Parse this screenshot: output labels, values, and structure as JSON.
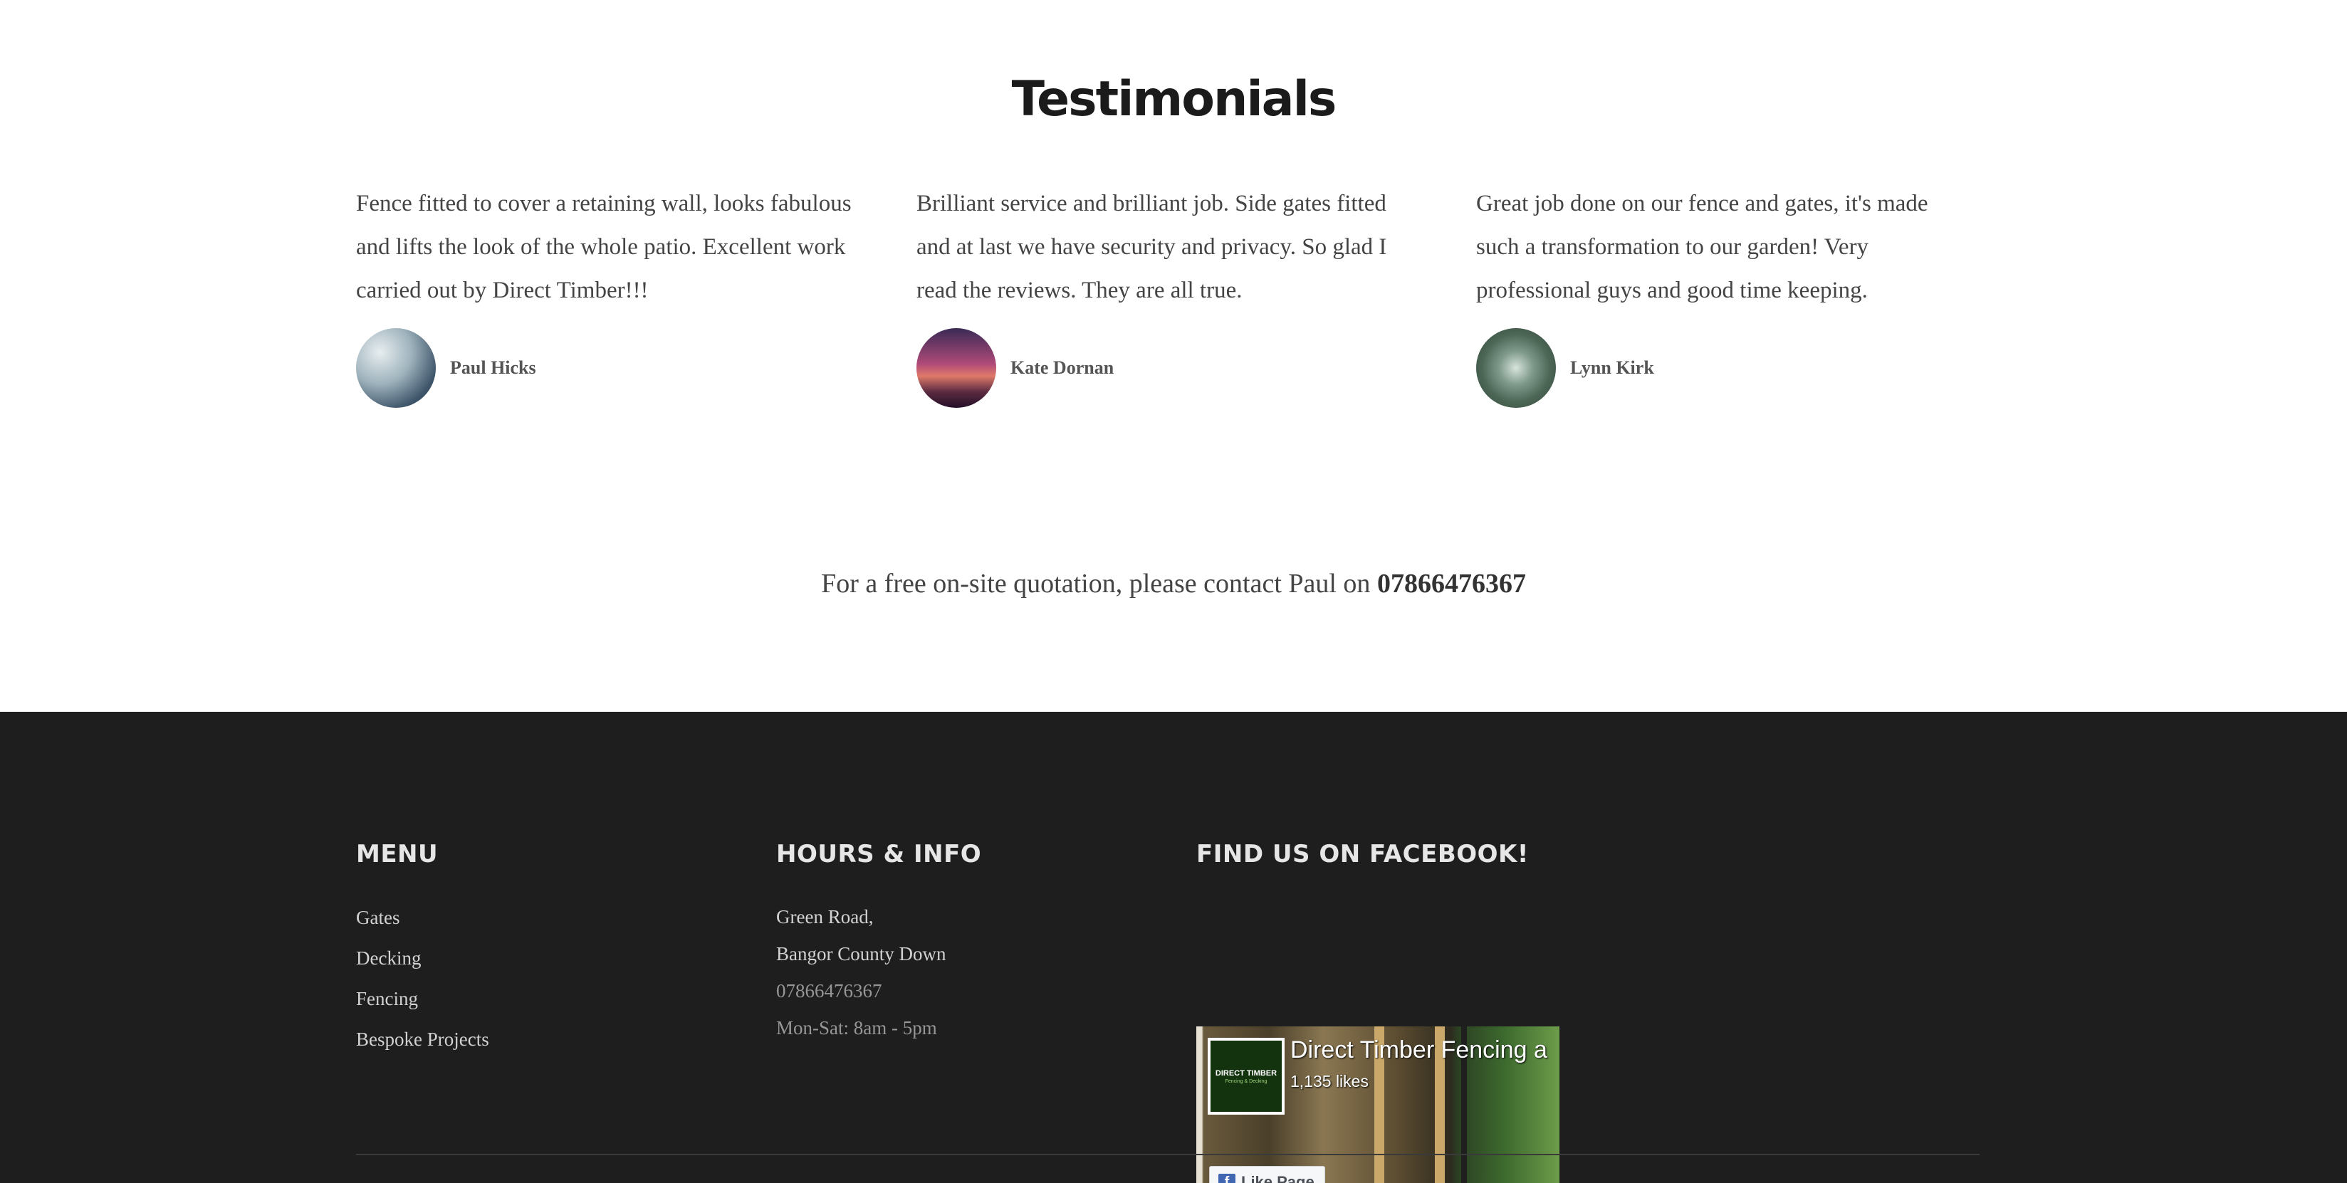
{
  "testimonials": {
    "title": "Testimonials",
    "items": [
      {
        "quote": "Fence fitted to cover a retaining wall, looks fabulous and lifts the look of the whole patio. Excellent work carried out by Direct Timber!!!",
        "author": "Paul Hicks"
      },
      {
        "quote": "Brilliant service and brilliant job. Side gates fitted and at last we have security and privacy. So glad I read the reviews. They are all true.",
        "author": "Kate Dornan"
      },
      {
        "quote": "Great job done on our fence and gates, it's made such a transformation to our garden! Very professional guys and good time keeping.",
        "author": "Lynn Kirk"
      }
    ]
  },
  "cta": {
    "text": "For a free on-site quotation, please contact Paul on",
    "phone": "07866476367"
  },
  "footer": {
    "menu": {
      "heading": "MENU",
      "items": [
        "Gates",
        "Decking",
        "Fencing",
        "Bespoke Projects"
      ]
    },
    "hours_info": {
      "heading": "HOURS & INFO",
      "address_line1": "Green Road,",
      "address_line2": "Bangor County Down",
      "phone": "07866476367",
      "hours": "Mon-Sat: 8am - 5pm"
    },
    "facebook": {
      "heading": "FIND US ON FACEBOOK!",
      "page_name": "Direct Timber Fencing a",
      "likes": "1,135 likes",
      "like_button": "Like Page",
      "logo_text": "DIRECT TIMBER",
      "logo_subtext": "Fencing & Decking"
    }
  },
  "colors": {
    "footer_bg": "#1e1e1e",
    "facebook_blue": "#4267b2"
  }
}
